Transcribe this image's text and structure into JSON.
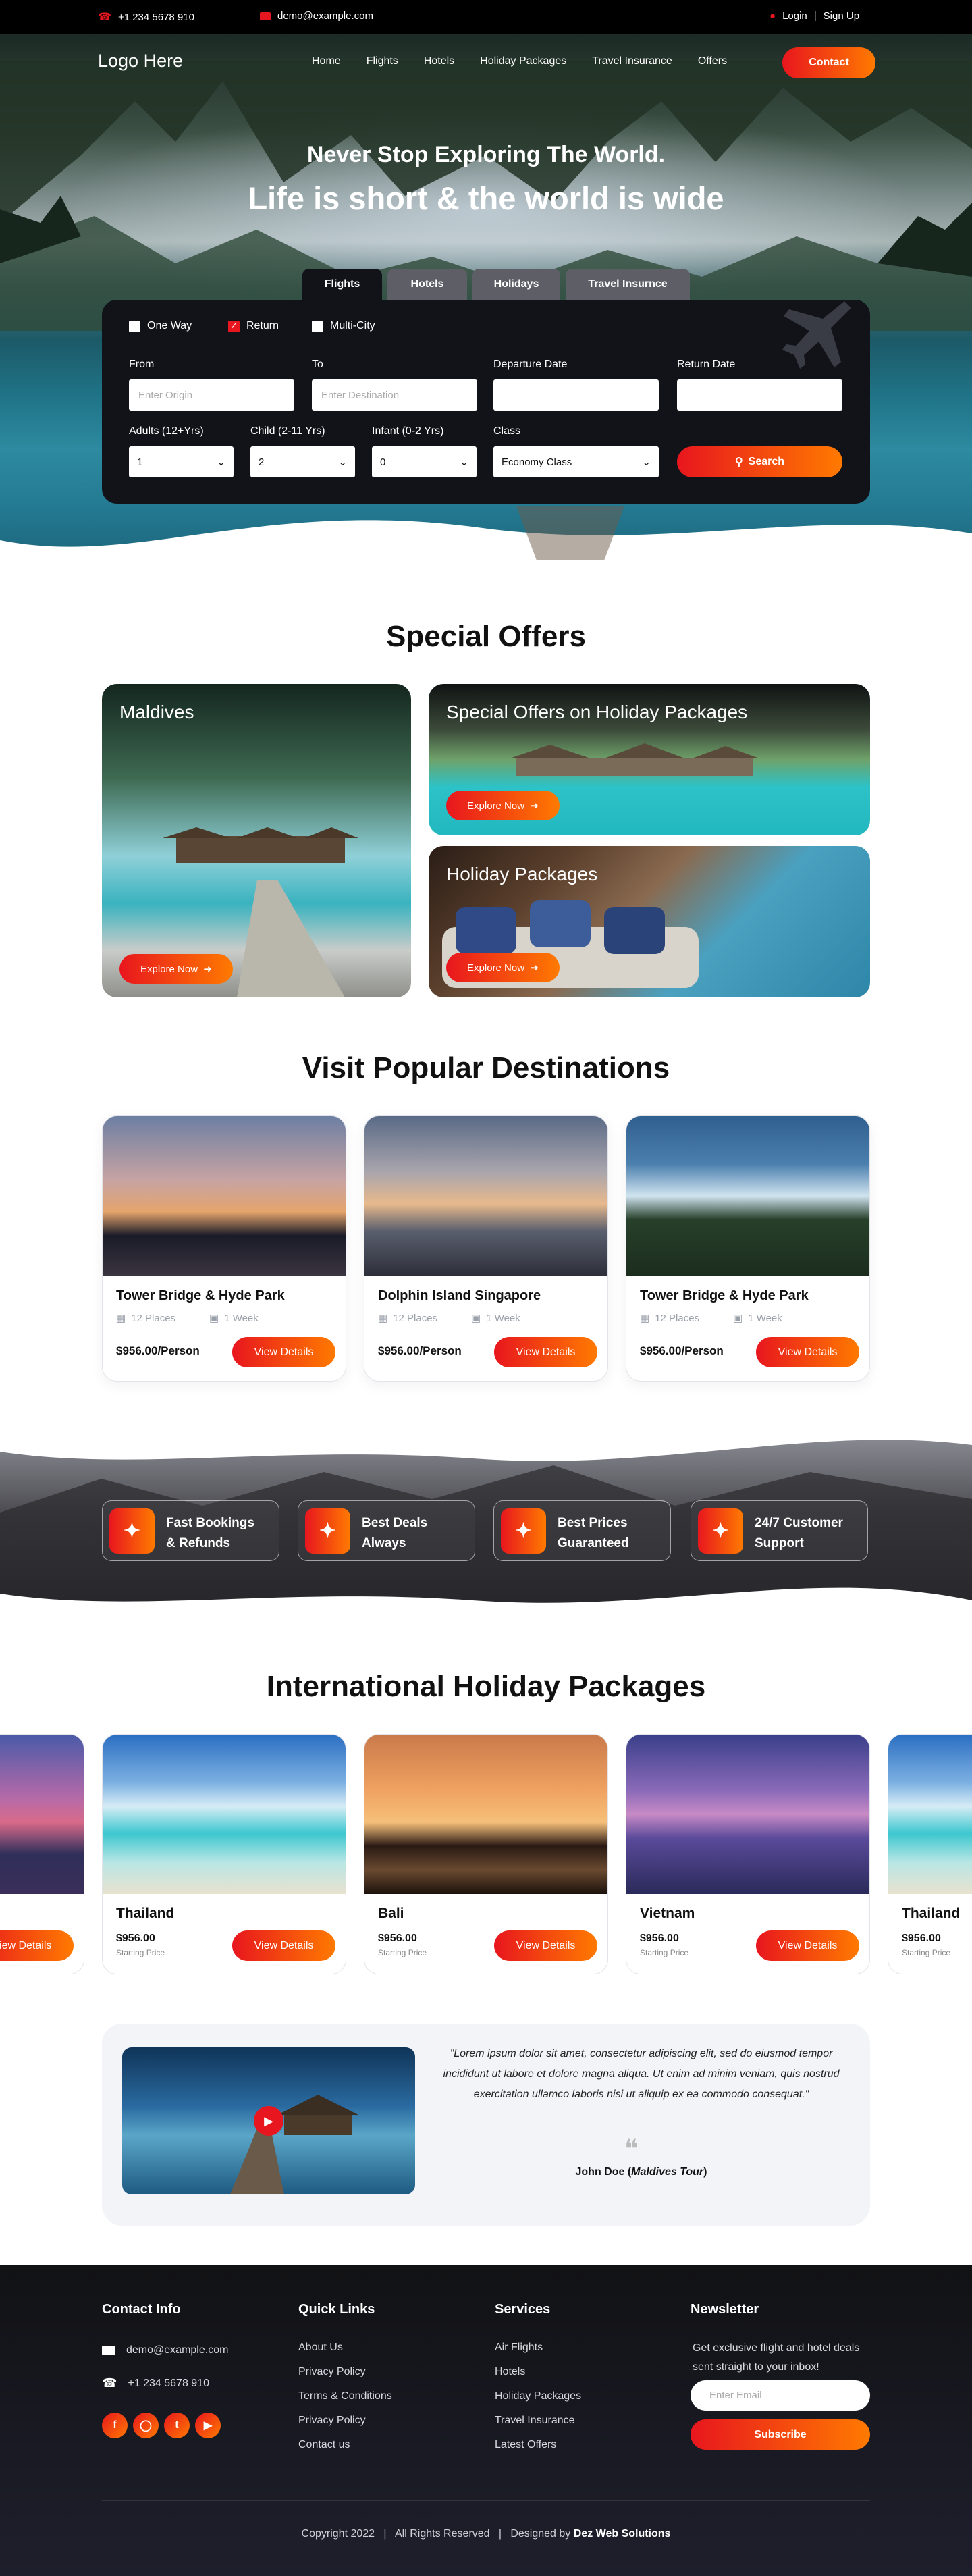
{
  "topbar": {
    "phone": "+1 234 5678 910",
    "email": "demo@example.com",
    "login": "Login",
    "separator": "|",
    "signup": "Sign Up"
  },
  "nav": {
    "logo": "Logo Here",
    "links": [
      "Home",
      "Flights",
      "Hotels",
      "Holiday Packages",
      "Travel Insurance",
      "Offers"
    ],
    "contact": "Contact"
  },
  "hero": {
    "title": "Never Stop Exploring The World.",
    "subtitle": "Life is short & the world is wide"
  },
  "search": {
    "tabs": [
      "Flights",
      "Hotels",
      "Holidays",
      "Travel Insurnce"
    ],
    "trip_types": [
      "One Way",
      "Return",
      "Multi-City"
    ],
    "from_label": "From",
    "from_placeholder": "Enter Origin",
    "to_label": "To",
    "to_placeholder": "Enter Destination",
    "departure_label": "Departure Date",
    "return_label": "Return Date",
    "adults_label": "Adults (12+Yrs)",
    "adults_value": "1",
    "child_label": "Child (2-11 Yrs)",
    "child_value": "2",
    "infant_label": "Infant (0-2 Yrs)",
    "infant_value": "0",
    "class_label": "Class",
    "class_value": "Economy Class",
    "search_button": "Search"
  },
  "offers": {
    "title": "Special Offers",
    "items": [
      {
        "title": "Maldives",
        "button": "Explore Now"
      },
      {
        "title": "Special Offers on Holiday Packages",
        "button": "Explore Now"
      },
      {
        "title": "Holiday Packages",
        "button": "Explore Now"
      }
    ]
  },
  "destinations": {
    "title": "Visit Popular Destinations",
    "items": [
      {
        "name": "Tower Bridge & Hyde Park",
        "places": "12 Places",
        "duration": "1 Week",
        "price": "$956.00/Person",
        "button": "View Details"
      },
      {
        "name": "Dolphin Island Singapore",
        "places": "12 Places",
        "duration": "1 Week",
        "price": "$956.00/Person",
        "button": "View Details"
      },
      {
        "name": "Tower Bridge & Hyde Park",
        "places": "12 Places",
        "duration": "1 Week",
        "price": "$956.00/Person",
        "button": "View Details"
      }
    ]
  },
  "features": [
    {
      "text": "Fast Bookings\n& Refunds"
    },
    {
      "text": "Best Deals\nAlways"
    },
    {
      "text": "Best Prices\nGuaranteed"
    },
    {
      "text": "24/7 Customer\nSupport"
    }
  ],
  "packages": {
    "title": "International Holiday Packages",
    "items": [
      {
        "name": "",
        "price": "",
        "starting": "",
        "button": "View Details"
      },
      {
        "name": "Thailand",
        "price": "$956.00",
        "starting": "Starting Price",
        "button": "View Details"
      },
      {
        "name": "Bali",
        "price": "$956.00",
        "starting": "Starting Price",
        "button": "View Details"
      },
      {
        "name": "Vietnam",
        "price": "$956.00",
        "starting": "Starting Price",
        "button": "View Details"
      },
      {
        "name": "Thailand",
        "price": "$956.00",
        "starting": "Starting Price",
        "button": ""
      }
    ]
  },
  "testimonial": {
    "quote": "\"Lorem ipsum dolor sit amet, consectetur adipiscing elit, sed do eiusmod tempor incididunt ut labore et dolore magna aliqua. Ut enim ad minim veniam, quis nostrud exercitation ullamco laboris nisi ut aliquip ex ea commodo consequat.\"",
    "author": "John Doe",
    "company": "Maldives Tour"
  },
  "footer": {
    "contact_title": "Contact Info",
    "email": "demo@example.com",
    "phone": "+1 234 5678 910",
    "quick_title": "Quick Links",
    "quick_links": [
      "About Us",
      "Privacy Policy",
      "Terms & Conditions",
      "Privacy Policy",
      "Contact us"
    ],
    "services_title": "Services",
    "services": [
      "Air Flights",
      "Hotels",
      "Holiday Packages",
      "Travel Insurance",
      "Latest Offers"
    ],
    "newsletter_title": "Newsletter",
    "newsletter_text": "Get exclusive flight and hotel deals sent straight to your inbox!",
    "newsletter_placeholder": "Enter Email",
    "subscribe": "Subscribe",
    "copyright": "Copyright 2022",
    "rights": "All Rights Reserved",
    "designed_by": "Designed by",
    "designer": "Dez Web Solutions"
  },
  "colors": {
    "accent_start": "#e8161e",
    "accent_end": "#ff7a00",
    "panel": "#111319",
    "footer": "#191a23"
  }
}
